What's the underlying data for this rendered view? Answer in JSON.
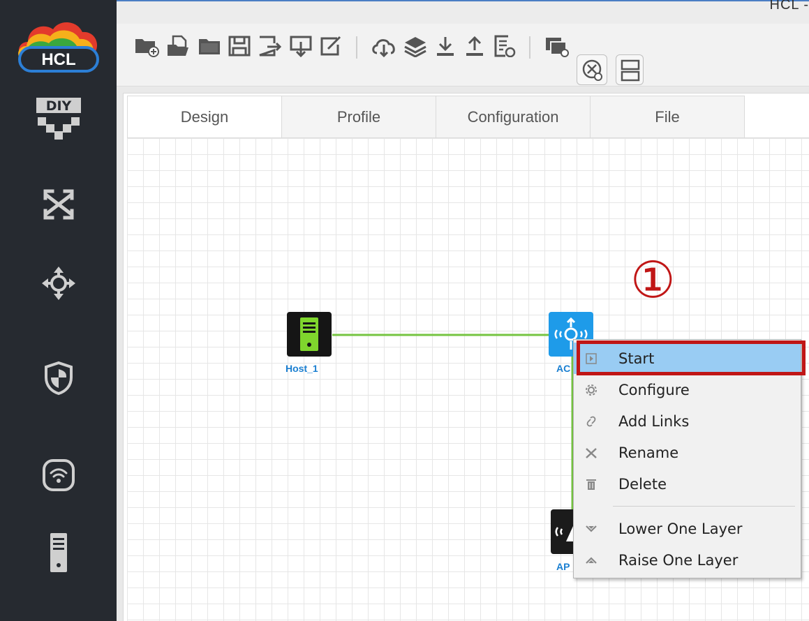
{
  "window": {
    "title_fragment": "HCL -"
  },
  "sidebar": {
    "logo_text": "HCL",
    "diy_text": "DIY",
    "items": [
      {
        "name": "switch-icon"
      },
      {
        "name": "router-icon"
      },
      {
        "name": "firewall-icon"
      },
      {
        "name": "wireless-icon"
      },
      {
        "name": "host-icon"
      }
    ]
  },
  "toolbar": {
    "buttons": [
      "new-topology-icon",
      "open-template-icon",
      "open-folder-icon",
      "save-icon",
      "save-as-icon",
      "export-icon",
      "edit-icon",
      "cloud-import-icon",
      "layers-icon",
      "download-icon",
      "upload-icon",
      "log-icon",
      "capture-icon",
      "show-interfaces-icon",
      "grid-icon"
    ]
  },
  "tabs": [
    {
      "label": "Design",
      "active": true
    },
    {
      "label": "Profile",
      "active": false
    },
    {
      "label": "Configuration",
      "active": false
    },
    {
      "label": "File",
      "active": false
    }
  ],
  "devices": {
    "host": {
      "label": "Host_1"
    },
    "ac": {
      "label": "AC"
    },
    "ap": {
      "label": "AP"
    }
  },
  "context_menu": {
    "items": [
      {
        "label": "Start",
        "icon": "play-icon",
        "highlighted": true
      },
      {
        "label": "Configure",
        "icon": "gear-icon"
      },
      {
        "label": "Add Links",
        "icon": "link-icon"
      },
      {
        "label": "Rename",
        "icon": "tools-icon"
      },
      {
        "label": "Delete",
        "icon": "trash-icon"
      },
      {
        "label": "Lower One Layer",
        "icon": "chevron-down-icon"
      },
      {
        "label": "Raise One Layer",
        "icon": "chevron-up-icon"
      }
    ]
  },
  "annotation": {
    "step_marker": "①"
  },
  "colors": {
    "highlight": "#99ccf3",
    "annotation_red": "#c01616",
    "link_green": "#76c442",
    "ac_blue": "#1e9be9"
  }
}
